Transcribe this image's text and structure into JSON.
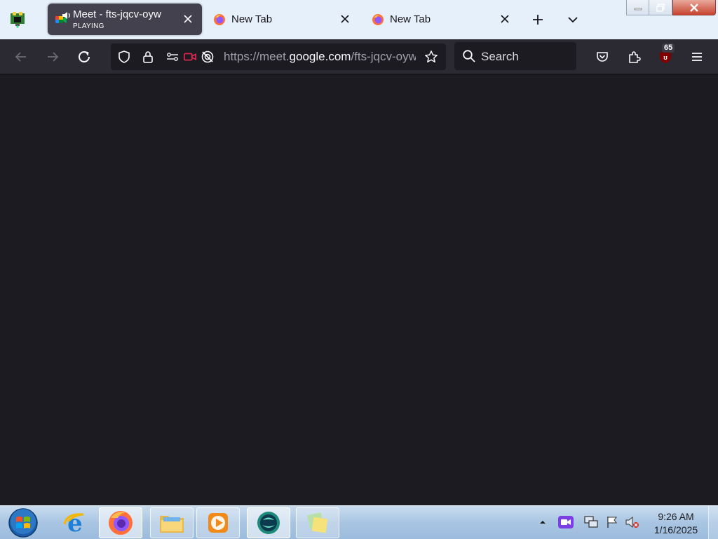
{
  "tabs": [
    {
      "title": "Meet - fts-jqcv-oyw",
      "status": "PLAYING",
      "active": true
    },
    {
      "title": "New Tab"
    },
    {
      "title": "New Tab"
    }
  ],
  "url": {
    "prefix": "https://meet.",
    "host": "google.com",
    "path": "/fts-jqcv-oyw"
  },
  "search": {
    "placeholder": "Search"
  },
  "extensions": {
    "badge_count": "65"
  },
  "clock": {
    "time": "9:26 AM",
    "date": "1/16/2025"
  },
  "colors": {
    "toolbar_bg": "#2b2a33",
    "content_bg": "#1c1b22",
    "camera_red": "#e22850",
    "active_tab": "#42414d"
  },
  "icons": [
    "back-arrow-icon",
    "forward-arrow-icon",
    "reload-icon",
    "shield-icon",
    "lock-icon",
    "permissions-icon",
    "camera-icon",
    "no-tracking-icon",
    "star-icon",
    "search-icon",
    "pocket-icon",
    "extensions-icon",
    "ublock-icon",
    "menu-icon",
    "plus-icon",
    "chevron-down-icon"
  ]
}
